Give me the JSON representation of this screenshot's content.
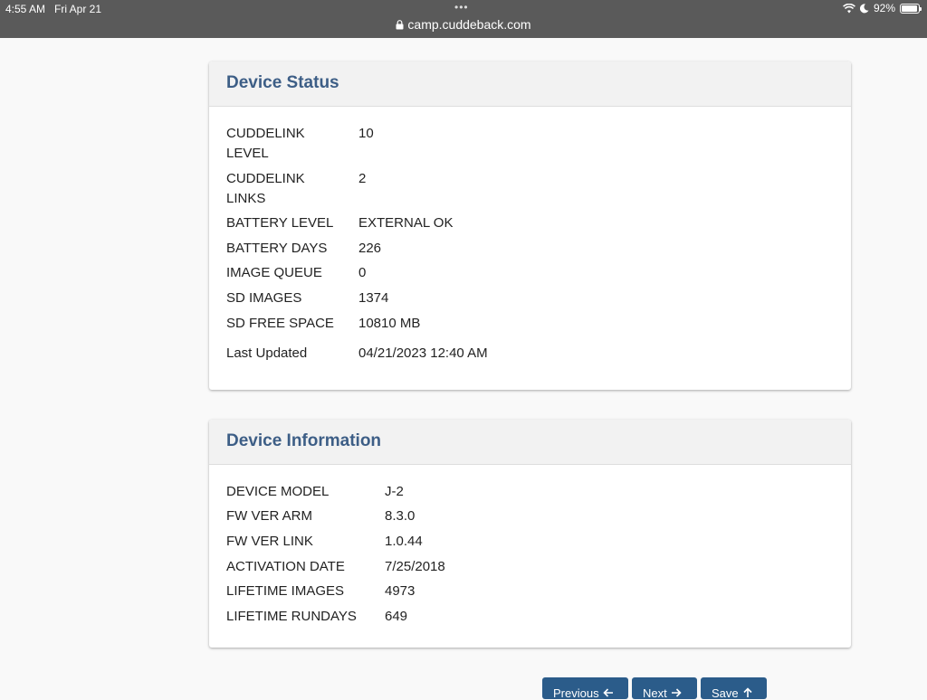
{
  "statusbar": {
    "time": "4:55 AM",
    "date": "Fri Apr 21",
    "battery_pct": "92%",
    "battery_level": 0.92
  },
  "browser": {
    "url": "camp.cuddeback.com"
  },
  "device_status": {
    "title": "Device Status",
    "rows": [
      {
        "label": "CUDDELINK LEVEL",
        "value": "10"
      },
      {
        "label": "CUDDELINK LINKS",
        "value": "2"
      },
      {
        "label": "BATTERY LEVEL",
        "value": "EXTERNAL OK"
      },
      {
        "label": "BATTERY DAYS",
        "value": "226"
      },
      {
        "label": "IMAGE QUEUE",
        "value": "0"
      },
      {
        "label": "SD IMAGES",
        "value": "1374"
      },
      {
        "label": "SD FREE SPACE",
        "value": "10810 MB"
      },
      {
        "label": "Last Updated",
        "value": "04/21/2023 12:40 AM"
      }
    ]
  },
  "device_info": {
    "title": "Device Information",
    "rows": [
      {
        "label": "DEVICE MODEL",
        "value": "J-2"
      },
      {
        "label": "FW VER ARM",
        "value": "8.3.0"
      },
      {
        "label": "FW VER LINK",
        "value": "1.0.44"
      },
      {
        "label": "ACTIVATION DATE",
        "value": "7/25/2018"
      },
      {
        "label": "LIFETIME IMAGES",
        "value": "4973"
      },
      {
        "label": "LIFETIME RUNDAYS",
        "value": "649"
      }
    ]
  },
  "buttons": {
    "previous": "Previous",
    "next": "Next",
    "save": "Save"
  },
  "colors": {
    "accent": "#2b5c8a",
    "heading": "#3d5e86"
  }
}
